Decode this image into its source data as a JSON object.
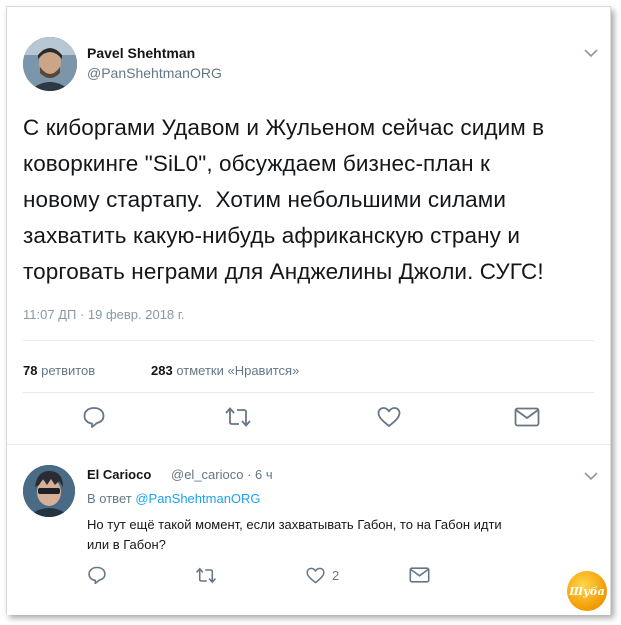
{
  "tweet": {
    "author_name": "Pavel Shehtman",
    "author_handle": "@PanShehtmanORG",
    "text_lines": [
      "С киборгами Удавом и Жульеном сейчас сидим в",
      "коворкинге \"SiL0\", обсуждаем бизнес-план к",
      "новому стартапу.  Хотим небольшими силами",
      "захватить какую-нибудь африканскую страну и",
      "торговать неграми для Анджелины Джоли. СУГС!"
    ],
    "timestamp": "11:07 ДП · 19 февр. 2018 г.",
    "retweets_count": "78",
    "retweets_label": "ретвитов",
    "likes_count": "283",
    "likes_label": "отметки «Нравится»"
  },
  "reply": {
    "author_name": "El Carioco",
    "author_handle": "@el_carioco",
    "time_ago": "6 ч",
    "reply_to_prefix": "В ответ",
    "reply_to_handle": "@PanShehtmanORG",
    "text_lines": [
      "Но тут ещё такой момент, если захватывать Габон, то на Габон идти",
      "или в Габон?"
    ],
    "likes_count": "2"
  },
  "watermark_text": "Шуба",
  "colors": {
    "accent": "#1da1f2",
    "text": "#14171a",
    "muted": "#657786",
    "divider": "#e6ecf0"
  },
  "icons": [
    "chevron-down-icon",
    "reply-icon",
    "retweet-icon",
    "like-icon",
    "message-icon"
  ]
}
